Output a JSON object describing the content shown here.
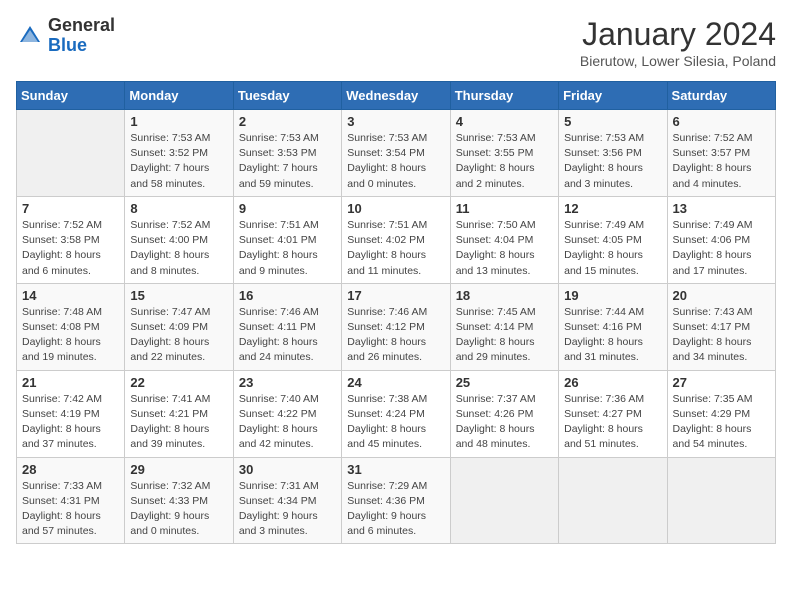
{
  "header": {
    "logo_general": "General",
    "logo_blue": "Blue",
    "month": "January 2024",
    "location": "Bierutow, Lower Silesia, Poland"
  },
  "weekdays": [
    "Sunday",
    "Monday",
    "Tuesday",
    "Wednesday",
    "Thursday",
    "Friday",
    "Saturday"
  ],
  "weeks": [
    [
      {
        "day": "",
        "info": ""
      },
      {
        "day": "1",
        "info": "Sunrise: 7:53 AM\nSunset: 3:52 PM\nDaylight: 7 hours\nand 58 minutes."
      },
      {
        "day": "2",
        "info": "Sunrise: 7:53 AM\nSunset: 3:53 PM\nDaylight: 7 hours\nand 59 minutes."
      },
      {
        "day": "3",
        "info": "Sunrise: 7:53 AM\nSunset: 3:54 PM\nDaylight: 8 hours\nand 0 minutes."
      },
      {
        "day": "4",
        "info": "Sunrise: 7:53 AM\nSunset: 3:55 PM\nDaylight: 8 hours\nand 2 minutes."
      },
      {
        "day": "5",
        "info": "Sunrise: 7:53 AM\nSunset: 3:56 PM\nDaylight: 8 hours\nand 3 minutes."
      },
      {
        "day": "6",
        "info": "Sunrise: 7:52 AM\nSunset: 3:57 PM\nDaylight: 8 hours\nand 4 minutes."
      }
    ],
    [
      {
        "day": "7",
        "info": "Sunrise: 7:52 AM\nSunset: 3:58 PM\nDaylight: 8 hours\nand 6 minutes."
      },
      {
        "day": "8",
        "info": "Sunrise: 7:52 AM\nSunset: 4:00 PM\nDaylight: 8 hours\nand 8 minutes."
      },
      {
        "day": "9",
        "info": "Sunrise: 7:51 AM\nSunset: 4:01 PM\nDaylight: 8 hours\nand 9 minutes."
      },
      {
        "day": "10",
        "info": "Sunrise: 7:51 AM\nSunset: 4:02 PM\nDaylight: 8 hours\nand 11 minutes."
      },
      {
        "day": "11",
        "info": "Sunrise: 7:50 AM\nSunset: 4:04 PM\nDaylight: 8 hours\nand 13 minutes."
      },
      {
        "day": "12",
        "info": "Sunrise: 7:49 AM\nSunset: 4:05 PM\nDaylight: 8 hours\nand 15 minutes."
      },
      {
        "day": "13",
        "info": "Sunrise: 7:49 AM\nSunset: 4:06 PM\nDaylight: 8 hours\nand 17 minutes."
      }
    ],
    [
      {
        "day": "14",
        "info": "Sunrise: 7:48 AM\nSunset: 4:08 PM\nDaylight: 8 hours\nand 19 minutes."
      },
      {
        "day": "15",
        "info": "Sunrise: 7:47 AM\nSunset: 4:09 PM\nDaylight: 8 hours\nand 22 minutes."
      },
      {
        "day": "16",
        "info": "Sunrise: 7:46 AM\nSunset: 4:11 PM\nDaylight: 8 hours\nand 24 minutes."
      },
      {
        "day": "17",
        "info": "Sunrise: 7:46 AM\nSunset: 4:12 PM\nDaylight: 8 hours\nand 26 minutes."
      },
      {
        "day": "18",
        "info": "Sunrise: 7:45 AM\nSunset: 4:14 PM\nDaylight: 8 hours\nand 29 minutes."
      },
      {
        "day": "19",
        "info": "Sunrise: 7:44 AM\nSunset: 4:16 PM\nDaylight: 8 hours\nand 31 minutes."
      },
      {
        "day": "20",
        "info": "Sunrise: 7:43 AM\nSunset: 4:17 PM\nDaylight: 8 hours\nand 34 minutes."
      }
    ],
    [
      {
        "day": "21",
        "info": "Sunrise: 7:42 AM\nSunset: 4:19 PM\nDaylight: 8 hours\nand 37 minutes."
      },
      {
        "day": "22",
        "info": "Sunrise: 7:41 AM\nSunset: 4:21 PM\nDaylight: 8 hours\nand 39 minutes."
      },
      {
        "day": "23",
        "info": "Sunrise: 7:40 AM\nSunset: 4:22 PM\nDaylight: 8 hours\nand 42 minutes."
      },
      {
        "day": "24",
        "info": "Sunrise: 7:38 AM\nSunset: 4:24 PM\nDaylight: 8 hours\nand 45 minutes."
      },
      {
        "day": "25",
        "info": "Sunrise: 7:37 AM\nSunset: 4:26 PM\nDaylight: 8 hours\nand 48 minutes."
      },
      {
        "day": "26",
        "info": "Sunrise: 7:36 AM\nSunset: 4:27 PM\nDaylight: 8 hours\nand 51 minutes."
      },
      {
        "day": "27",
        "info": "Sunrise: 7:35 AM\nSunset: 4:29 PM\nDaylight: 8 hours\nand 54 minutes."
      }
    ],
    [
      {
        "day": "28",
        "info": "Sunrise: 7:33 AM\nSunset: 4:31 PM\nDaylight: 8 hours\nand 57 minutes."
      },
      {
        "day": "29",
        "info": "Sunrise: 7:32 AM\nSunset: 4:33 PM\nDaylight: 9 hours\nand 0 minutes."
      },
      {
        "day": "30",
        "info": "Sunrise: 7:31 AM\nSunset: 4:34 PM\nDaylight: 9 hours\nand 3 minutes."
      },
      {
        "day": "31",
        "info": "Sunrise: 7:29 AM\nSunset: 4:36 PM\nDaylight: 9 hours\nand 6 minutes."
      },
      {
        "day": "",
        "info": ""
      },
      {
        "day": "",
        "info": ""
      },
      {
        "day": "",
        "info": ""
      }
    ]
  ]
}
